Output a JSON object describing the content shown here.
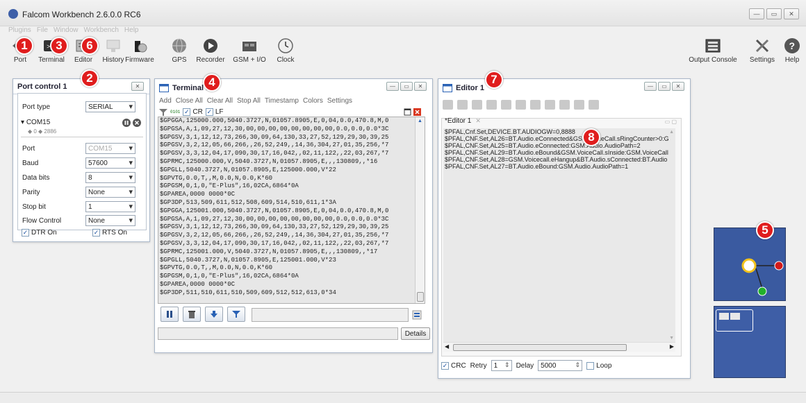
{
  "window": {
    "title": "Falcom Workbench 2.6.0.0 RC6",
    "controls": [
      "—",
      "▭",
      "✕"
    ]
  },
  "menu": [
    "Plugins",
    "File",
    "Window",
    "Workbench",
    "Help"
  ],
  "toolbar": {
    "left": [
      {
        "label": "Port",
        "icon": "port-icon"
      },
      {
        "label": "Terminal",
        "icon": "terminal-icon"
      },
      {
        "label": "Editor",
        "icon": "editor-icon"
      },
      {
        "label": "History",
        "icon": "history-icon"
      },
      {
        "label": "Firmware",
        "icon": "firmware-icon"
      },
      {
        "label": "GPS",
        "icon": "gps-globe-icon"
      },
      {
        "label": "Recorder",
        "icon": "recorder-icon"
      },
      {
        "label": "GSM + I/O",
        "icon": "gsm-io-icon"
      },
      {
        "label": "Clock",
        "icon": "clock-icon"
      }
    ],
    "right": [
      {
        "label": "Output Console",
        "icon": "output-console-icon"
      },
      {
        "label": "Settings",
        "icon": "settings-tools-icon"
      },
      {
        "label": "Help",
        "icon": "help-icon"
      }
    ]
  },
  "badges": [
    "1",
    "2",
    "3",
    "4",
    "5",
    "6",
    "7",
    "8"
  ],
  "port_control": {
    "title": "Port control 1",
    "close": "✕",
    "port_type_label": "Port type",
    "port_type_value": "SERIAL",
    "com_name": "COM15",
    "com_stats": "◆ 0 ◆ 2886",
    "fields": [
      {
        "label": "Port",
        "value": "COM15",
        "disabled": true
      },
      {
        "label": "Baud",
        "value": "57600",
        "disabled": false
      },
      {
        "label": "Data bits",
        "value": "8",
        "disabled": false
      },
      {
        "label": "Parity",
        "value": "None",
        "disabled": false
      },
      {
        "label": "Stop bit",
        "value": "1",
        "disabled": false
      },
      {
        "label": "Flow Control",
        "value": "None",
        "disabled": false
      }
    ],
    "dtr": "DTR On",
    "rts": "RTS On"
  },
  "terminal": {
    "title": "Terminal 1",
    "menu": [
      "Add",
      "Close All",
      "Clear All",
      "Stop All",
      "Timestamp",
      "Colors",
      "Settings"
    ],
    "hex_label": "0101",
    "cr": "CR",
    "lf": "LF",
    "lines": [
      "$GPGGA,125000.000,5040.3727,N,01057.8905,E,0,04,0.0,470.8,M,0",
      "$GPGSA,A,1,09,27,12,30,00,00,00,00,00,00,00,00,0.0,0.0,0.0*3C",
      "$GPGSV,3,1,12,12,73,266,30,09,64,130,33,27,52,129,29,30,39,25",
      "$GPGSV,3,2,12,05,66,266,,26,52,249,,14,36,304,27,01,35,256,*7",
      "$GPGSV,3,3,12,04,17,090,30,17,16,042,,02,11,122,,22,03,267,*7",
      "$GPRMC,125000.000,V,5040.3727,N,01057.8905,E,,,130809,,*16",
      "$GPGLL,5040.3727,N,01057.8905,E,125000.000,V*22",
      "$GPVTG,0.0,T,,M,0.0,N,0.0,K*60",
      "$GPGSM,0,1,0,\"E-Plus\",16,02CA,6864*0A",
      "$GPAREA,0000 0000*0C",
      "$GP3DP,513,509,611,512,508,609,514,510,611,1*3A",
      "$GPGGA,125001.000,5040.3727,N,01057.8905,E,0,04,0.0,470.8,M,0",
      "$GPGSA,A,1,09,27,12,30,00,00,00,00,00,00,00,00,0.0,0.0,0.0*3C",
      "$GPGSV,3,1,12,12,73,266,30,09,64,130,33,27,52,129,29,30,39,25",
      "$GPGSV,3,2,12,05,66,266,,26,52,249,,14,36,304,27,01,35,256,*7",
      "$GPGSV,3,3,12,04,17,090,30,17,16,042,,02,11,122,,22,03,267,*7",
      "$GPRMC,125001.000,V,5040.3727,N,01057.8905,E,,,130809,,*17",
      "$GPGLL,5040.3727,N,01057.8905,E,125001.000,V*23",
      "$GPVTG,0.0,T,,M,0.0,N,0.0,K*60",
      "$GPGSM,0,1,0,\"E-Plus\",16,02CA,6864*0A",
      "$GPAREA,0000 0000*0C",
      "$GP3DP,511,510,611,510,509,609,512,512,613,0*34"
    ],
    "details_button": "Details"
  },
  "editor": {
    "title": "Editor 1",
    "tab_label": "*Editor 1",
    "lines": [
      "$PFAL,Cnf.Set,DEVICE.BT.AUDIOGW=0,8888",
      "$PFAL,CNF.Set,AL26=BT.Audio.eConnected&GSM.VoiceCall.sRingCounter>0:G",
      "$PFAL,CNF.Set,AL25=BT.Audio.eConnected:GSM.Audio.AudioPath=2",
      "$PFAL,CNF.Set,AL29=BT.Audio.eBound&GSM.VoiceCall.sInside:GSM.VoiceCall",
      "$PFAL,CNF.Set,AL28=GSM.Voicecall.eHangup&BT.Audio.sConnected:BT.Audio",
      "$PFAL,CNF.Set,AL27=BT.Audio.eBound:GSM.Audio.AudioPath=1"
    ],
    "crc_label": "CRC",
    "retry_label": "Retry",
    "retry_value": "1",
    "delay_label": "Delay",
    "delay_value": "5000",
    "loop_label": "Loop"
  },
  "colors": {
    "badge": "#e01d1d",
    "nav": "#3a5aa0",
    "node_ring": "#f2c21b",
    "node_red": "#d21a1a",
    "node_green": "#22b02a"
  }
}
